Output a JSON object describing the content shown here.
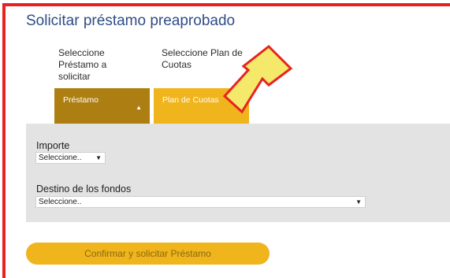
{
  "page": {
    "title": "Solicitar préstamo preaprobado"
  },
  "steps": {
    "loan_label": "Seleccione Préstamo a solicitar",
    "plan_label": "Seleccione Plan de Cuotas"
  },
  "tabs": {
    "loan": {
      "label": "Préstamo",
      "arrow": "▲",
      "state": "collapsed"
    },
    "plan": {
      "label": "Plan de Cuotas",
      "arrow": "▼",
      "state": "expanded"
    }
  },
  "form": {
    "amount_label": "Importe",
    "amount_value": "Seleccione..",
    "destination_label": "Destino de los fondos",
    "destination_value": "Seleccione.."
  },
  "actions": {
    "confirm_label": "Confirmar y solicitar Préstamo"
  },
  "colors": {
    "title": "#2f4d86",
    "loan_tab": "#ad7f12",
    "plan_tab": "#f0b41c",
    "panel_bg": "#e3e3e3",
    "frame_border": "#e8231f",
    "callout_arrow": "#f4e96a"
  },
  "icons": {
    "callout": "yellow-arrow-pointing-to-plan-tab",
    "dropdown": "caret-down-icon"
  }
}
